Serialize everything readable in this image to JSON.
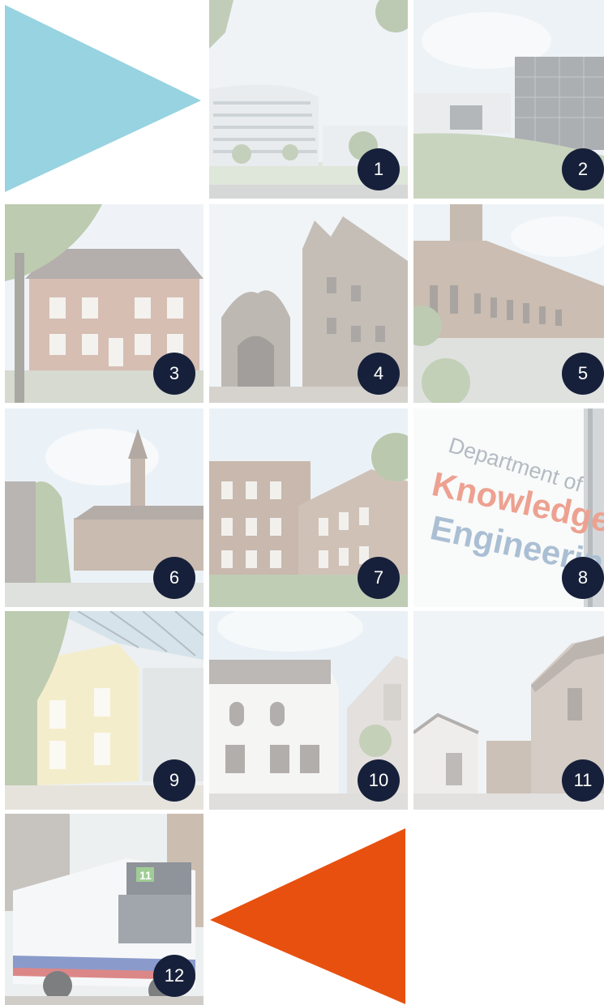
{
  "colors": {
    "badge": "#17203a",
    "triangle_top": "#97d3e0",
    "triangle_bottom": "#e8500f"
  },
  "decor": {
    "triangle_top": {
      "icon": "triangle-right-icon"
    },
    "triangle_bottom": {
      "icon": "triangle-left-icon"
    }
  },
  "tiles": [
    {
      "number": "1"
    },
    {
      "number": "2"
    },
    {
      "number": "3"
    },
    {
      "number": "4"
    },
    {
      "number": "5"
    },
    {
      "number": "6"
    },
    {
      "number": "7"
    },
    {
      "number": "8",
      "sign": {
        "line1": "Department of",
        "line2": "Knowledge",
        "line3": "Engineering"
      }
    },
    {
      "number": "9"
    },
    {
      "number": "10"
    },
    {
      "number": "11"
    },
    {
      "number": "12",
      "bus_route": "11"
    }
  ]
}
